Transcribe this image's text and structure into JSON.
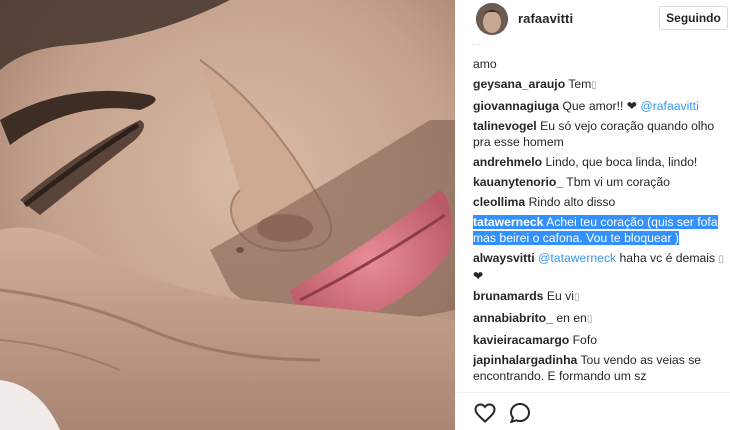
{
  "header": {
    "username": "rafaavitti",
    "follow_label": "Seguindo"
  },
  "comments": [
    {
      "user": "",
      "text": "amo"
    },
    {
      "user": "geysana_araujo",
      "text": "Tem",
      "suffix_icon": "missing-glyph-icon"
    },
    {
      "user": "giovannagiuga",
      "text": "Que amor!! ❤ ",
      "mention": "@rafaavitti"
    },
    {
      "user": "talinevogel",
      "text": "Eu só vejo coração quando olho pra esse homem"
    },
    {
      "user": "andrehmelo",
      "text": "Lindo, que boca linda, lindo!"
    },
    {
      "user": "kauanytenorio_",
      "text": "Tbm vi um coração"
    },
    {
      "user": "cleollima",
      "text": "Rindo alto disso"
    },
    {
      "user": "tatawerneck",
      "text": "Achei teu coração (quis ser fofa mas beirei o cafona. Vou te bloquear )",
      "highlighted": true
    },
    {
      "user": "alwaysvitti",
      "text": " haha vc é demais ",
      "mention": "@tatawerneck",
      "suffix": "❤"
    },
    {
      "user": "brunamards",
      "text": "Eu vi",
      "suffix_icon": "missing-glyph-icon"
    },
    {
      "user": "annabiabrito_",
      "text": "en en",
      "suffix_icon": "missing-glyph-icon"
    },
    {
      "user": "kavieiracamargo",
      "text": "Fofo"
    },
    {
      "user": "japinhalargadinha",
      "text": "Tou vendo as veias se encontrando. E formando um sz"
    }
  ],
  "actions": {
    "like_icon": "heart-icon",
    "comment_icon": "comment-icon"
  },
  "colors": {
    "mention": "#3897f0",
    "highlight": "#3390ff",
    "text": "#262626",
    "border": "#dbdbdb"
  }
}
